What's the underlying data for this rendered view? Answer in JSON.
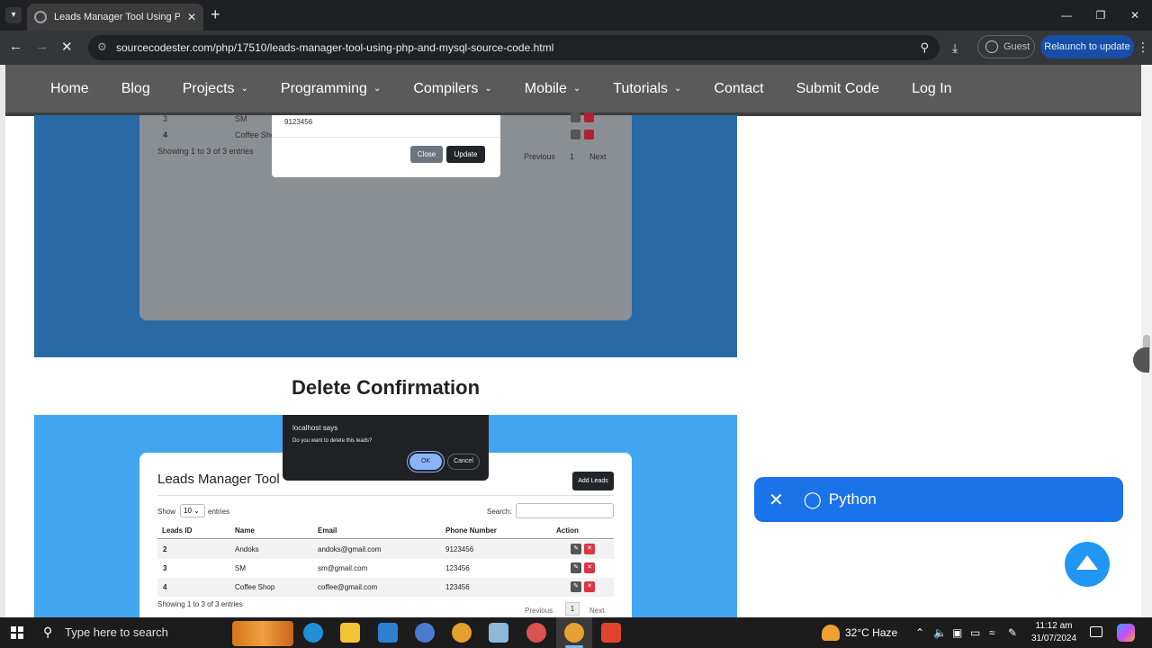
{
  "browser": {
    "tab_title": "Leads Manager Tool Using PHP",
    "url": "sourcecodester.com/php/17510/leads-manager-tool-using-php-and-mysql-source-code.html",
    "guest_label": "Guest",
    "relaunch_label": "Relaunch to update"
  },
  "site_nav": {
    "items": [
      {
        "label": "Home"
      },
      {
        "label": "Blog"
      },
      {
        "label": "Projects"
      },
      {
        "label": "Programming"
      },
      {
        "label": "Compilers"
      },
      {
        "label": "Mobile"
      },
      {
        "label": "Tutorials"
      },
      {
        "label": "Contact"
      },
      {
        "label": "Submit Code"
      },
      {
        "label": "Log In"
      }
    ]
  },
  "screenshot_top": {
    "row_3_id": "3",
    "row_3_name": "SM",
    "row_4_id": "4",
    "row_4_name": "Coffee Sho",
    "info": "Showing 1 to 3 of 3 entries",
    "prev": "Previous",
    "page": "1",
    "next": "Next",
    "modal_value": "9123456",
    "close_label": "Close",
    "update_label": "Update"
  },
  "section_heading": "Delete Confirmation",
  "screenshot_bottom": {
    "card_title": "Leads Manager Tool",
    "add_label": "Add Leads",
    "show_label": "Show",
    "show_value": "10",
    "entries_label": "entries",
    "search_label": "Search:",
    "headers": [
      "Leads ID",
      "Name",
      "Email",
      "Phone Number",
      "Action"
    ],
    "rows": [
      {
        "id": "2",
        "name": "Andoks",
        "email": "andoks@gmail.com",
        "phone": "9123456"
      },
      {
        "id": "3",
        "name": "SM",
        "email": "sm@gmail.com",
        "phone": "123456"
      },
      {
        "id": "4",
        "name": "Coffee Shop",
        "email": "coffee@gmail.com",
        "phone": "123456"
      }
    ],
    "info": "Showing 1 to 3 of 3 entries",
    "prev": "Previous",
    "page": "1",
    "next": "Next"
  },
  "alert": {
    "title": "localhost says",
    "message": "Do you want to delete this leads?",
    "ok": "OK",
    "cancel": "Cancel"
  },
  "tag_banner": {
    "label": "Python"
  },
  "taskbar": {
    "search_placeholder": "Type here to search",
    "weather": "32°C  Haze",
    "time": "11:12 am",
    "date": "31/07/2024"
  }
}
